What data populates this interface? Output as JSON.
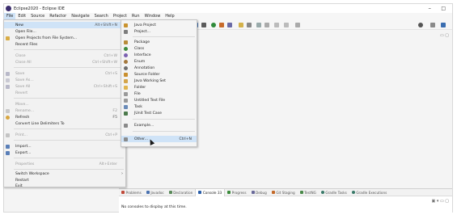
{
  "window": {
    "title": "Eclipse2020 - Eclipse IDE",
    "minimize_glyph": "–",
    "maximize_glyph": "□"
  },
  "menubar": {
    "items": [
      "File",
      "Edit",
      "Source",
      "Refactor",
      "Navigate",
      "Search",
      "Project",
      "Run",
      "Window",
      "Help"
    ]
  },
  "file_menu": {
    "items": [
      {
        "label": "New",
        "accel": "Alt+Shift+N",
        "arrow": "›",
        "icon": "new-icon"
      },
      {
        "label": "Open File...",
        "accel": "",
        "arrow": "",
        "icon": ""
      },
      {
        "label": "Open Projects from File System...",
        "accel": "",
        "arrow": "",
        "icon": "folder-icon"
      },
      {
        "label": "Recent Files",
        "accel": "",
        "arrow": "›",
        "icon": ""
      },
      {
        "label": "Close",
        "accel": "Ctrl+W",
        "arrow": "",
        "icon": ""
      },
      {
        "label": "Close All",
        "accel": "Ctrl+Shift+W",
        "arrow": "",
        "icon": ""
      },
      {
        "label": "Save",
        "accel": "Ctrl+S",
        "arrow": "",
        "icon": "save-icon"
      },
      {
        "label": "Save As...",
        "accel": "",
        "arrow": "",
        "icon": "save-as-icon"
      },
      {
        "label": "Save All",
        "accel": "Ctrl+Shift+S",
        "arrow": "",
        "icon": "save-all-icon"
      },
      {
        "label": "Revert",
        "accel": "",
        "arrow": "",
        "icon": ""
      },
      {
        "label": "Move...",
        "accel": "",
        "arrow": "",
        "icon": ""
      },
      {
        "label": "Rename...",
        "accel": "F2",
        "arrow": "",
        "icon": "rename-icon"
      },
      {
        "label": "Refresh",
        "accel": "F5",
        "arrow": "",
        "icon": "refresh-icon"
      },
      {
        "label": "Convert Line Delimiters To",
        "accel": "",
        "arrow": "›",
        "icon": ""
      },
      {
        "label": "Print...",
        "accel": "Ctrl+P",
        "arrow": "",
        "icon": "print-icon"
      },
      {
        "label": "Import...",
        "accel": "",
        "arrow": "",
        "icon": "import-icon"
      },
      {
        "label": "Export...",
        "accel": "",
        "arrow": "",
        "icon": "export-icon"
      },
      {
        "label": "Properties",
        "accel": "Alt+Enter",
        "arrow": "",
        "icon": ""
      },
      {
        "label": "Switch Workspace",
        "accel": "",
        "arrow": "›",
        "icon": ""
      },
      {
        "label": "Restart",
        "accel": "",
        "arrow": "",
        "icon": ""
      },
      {
        "label": "Exit",
        "accel": "",
        "arrow": "",
        "icon": ""
      }
    ]
  },
  "new_menu": {
    "items": [
      {
        "label": "Java Project",
        "accel": "",
        "icon": "java-project-icon",
        "color": "#c9922e"
      },
      {
        "label": "Project...",
        "accel": "",
        "icon": "project-icon",
        "color": "#7d7d7d"
      },
      {
        "label": "Package",
        "accel": "",
        "icon": "package-icon",
        "color": "#b78b3a"
      },
      {
        "label": "Class",
        "accel": "",
        "icon": "class-icon",
        "color": "#3d8b3d"
      },
      {
        "label": "Interface",
        "accel": "",
        "icon": "interface-icon",
        "color": "#7a5fb0"
      },
      {
        "label": "Enum",
        "accel": "",
        "icon": "enum-icon",
        "color": "#a4783c"
      },
      {
        "label": "Annotation",
        "accel": "",
        "icon": "annotation-icon",
        "color": "#6f6f6f"
      },
      {
        "label": "Source Folder",
        "accel": "",
        "icon": "source-folder-icon",
        "color": "#c98f2e"
      },
      {
        "label": "Java Working Set",
        "accel": "",
        "icon": "working-set-icon",
        "color": "#d4a54a"
      },
      {
        "label": "Folder",
        "accel": "",
        "icon": "folder-icon",
        "color": "#e0b54f"
      },
      {
        "label": "File",
        "accel": "",
        "icon": "file-icon",
        "color": "#9a9a9a"
      },
      {
        "label": "Untitled Text File",
        "accel": "",
        "icon": "text-file-icon",
        "color": "#9a9a9a"
      },
      {
        "label": "Task",
        "accel": "",
        "icon": "task-icon",
        "color": "#6a8bb8"
      },
      {
        "label": "JUnit Test Case",
        "accel": "",
        "icon": "junit-icon",
        "color": "#4c7a4c"
      },
      {
        "label": "Example...",
        "accel": "",
        "icon": "example-icon",
        "color": "#8a8a8a"
      },
      {
        "label": "Other...",
        "accel": "Ctrl+N",
        "icon": "other-icon",
        "color": "#8a8a8a"
      }
    ]
  },
  "console": {
    "tabs": [
      {
        "label": "Problems",
        "color": "#c04a3a"
      },
      {
        "label": "Javadoc",
        "color": "#4a72b0"
      },
      {
        "label": "Declaration",
        "color": "#5a8a5a"
      },
      {
        "label": "Console",
        "badge": "33",
        "color": "#2a5ea8",
        "active": true
      },
      {
        "label": "Progress",
        "color": "#3a8a3a"
      },
      {
        "label": "Debug",
        "color": "#6a6a9a"
      },
      {
        "label": "Git Staging",
        "color": "#c46a2a"
      },
      {
        "label": "TestNG",
        "color": "#4a8a4a"
      },
      {
        "label": "Gradle Tasks",
        "color": "#3a7a6a"
      },
      {
        "label": "Gradle Executions",
        "color": "#3a7a6a"
      }
    ],
    "message": "No consoles to display at this time."
  }
}
